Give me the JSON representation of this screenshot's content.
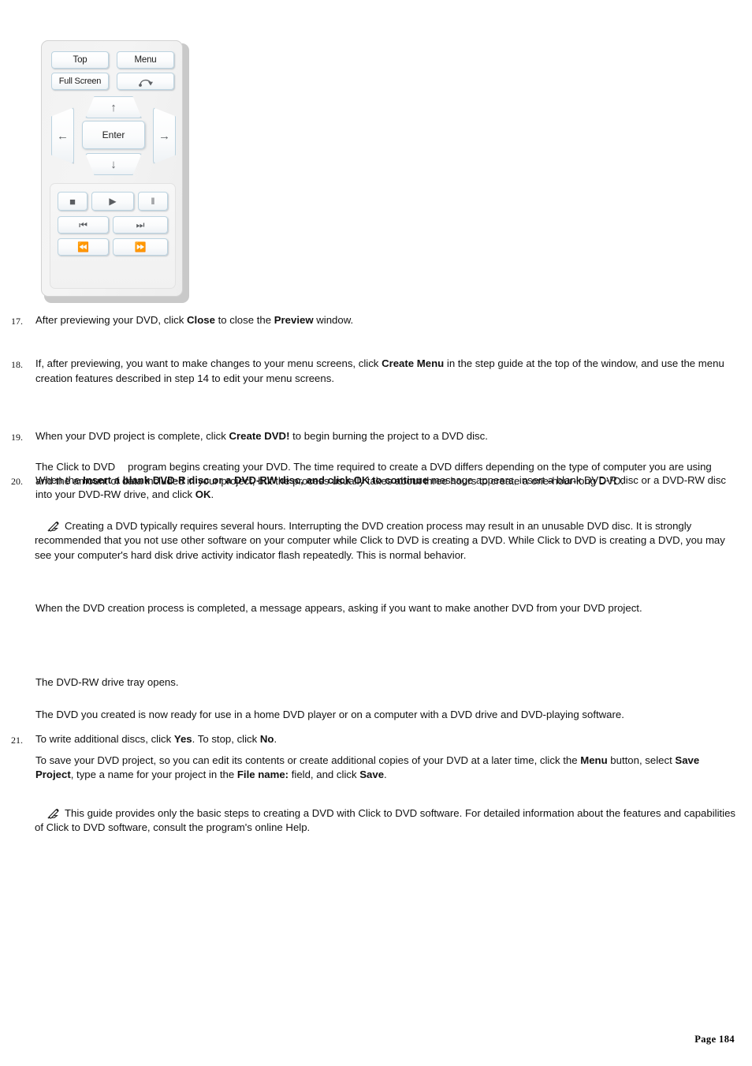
{
  "remote": {
    "name": "dvd-remote-control-panel",
    "buttons": {
      "top": "Top",
      "menu": "Menu",
      "full_screen": "Full Screen",
      "return_icon": "return-arrow-icon",
      "up_icon": "arrow-up-icon",
      "down_icon": "arrow-down-icon",
      "left_icon": "arrow-left-icon",
      "right_icon": "arrow-right-icon",
      "enter": "Enter",
      "stop_icon": "stop-icon",
      "play_icon": "play-icon",
      "pause_icon": "pause-icon",
      "previous_icon": "previous-track-icon",
      "next_icon": "next-track-icon",
      "rewind_icon": "rewind-icon",
      "fast_forward_icon": "fast-forward-icon"
    },
    "glyphs": {
      "up": "↑",
      "down": "↓",
      "left": "←",
      "right": "→",
      "stop": "■",
      "play": "▶",
      "pause": "‖",
      "previous": "⏮",
      "next": "⏭",
      "rewind": "⏪",
      "fast_forward": "⏩"
    }
  },
  "steps": [
    {
      "number": "17.",
      "name": "step-17"
    },
    {
      "number": "18.",
      "name": "step-18"
    },
    {
      "number": "19.",
      "name": "step-19"
    },
    {
      "number": "20.",
      "name": "step-20"
    },
    {
      "number": "21.",
      "name": "step-21"
    }
  ],
  "content": {
    "step17": {
      "p1": "After previewing your DVD, click ",
      "b1": "Close",
      "p2": " to close the ",
      "b2": "Preview",
      "p3": " window."
    },
    "step18": {
      "p1": "If, after previewing, you want to make changes to your menu screens, click ",
      "b1": "Create Menu",
      "p2": " in the step guide at the top of the window, and use the menu creation features described in step 14 to edit your menu screens."
    },
    "step19": {
      "p1": "When your DVD project is complete, click ",
      "b1": "Create DVD!",
      "p2": " to begin burning the project to a DVD disc."
    },
    "step20": {
      "p1": "When the ",
      "b1": "Insert a blank DVD-R disc or a DVD-RW disc, and click OK to continue",
      "p2": " message appears, insert a blank DVD-R disc or a DVD-RW disc into your DVD-RW drive, and click ",
      "b2": "OK",
      "p3": "."
    },
    "para_creating": {
      "p1": "The Click to DVD",
      "p2": "program begins creating your DVD. The time required to create a DVD differs depending on the type of computer you are using and the amount of data included in your project, but the process usually takes about three hours to create a one-hour-long DVD."
    },
    "note1": {
      "icon": "note-pencil-icon",
      "text": "Creating a DVD typically requires several hours. Interrupting the DVD creation process may result in an unusable DVD disc. It is strongly recommended that you not use other software on your computer while Click to DVD is creating a DVD. While Click to DVD is creating a DVD, you may see your computer's hard disk drive activity indicator flash repeatedly. This is normal behavior."
    },
    "para_completed": {
      "text": "When the DVD creation process is completed, a message appears, asking if you want to make another DVD from your DVD project."
    },
    "step21": {
      "p1": "To write additional discs, click ",
      "b1": "Yes",
      "p2": ". To stop, click ",
      "b2": "No",
      "p3": "."
    },
    "para_tray": {
      "text": "The DVD-RW drive tray opens."
    },
    "para_ready": {
      "text": "The DVD you created is now ready for use in a home DVD player or on a computer with a DVD drive and DVD-playing software."
    },
    "para_save": {
      "p1": "To save your DVD project, so you can edit its contents or create additional copies of your DVD at a later time, click the ",
      "b1": "Menu",
      "p2": " button, select ",
      "b2": "Save Project",
      "p3": ", type a name for your project in the ",
      "b3": "File name:",
      "p4": " field, and click ",
      "b4": "Save",
      "p5": "."
    },
    "note2": {
      "icon": "note-pencil-icon",
      "text": "This guide provides only the basic steps to creating a DVD with Click to DVD software. For detailed information about the features and capabilities of Click to DVD software, consult the program's online Help."
    }
  },
  "footer": {
    "page_label": "Page 184"
  },
  "colors": {
    "page_background": "#ffffff",
    "text": "#111111",
    "button_border": "#bcd3e0",
    "panel_background": "#f2f2f2",
    "glyph": "#5a5d61"
  }
}
